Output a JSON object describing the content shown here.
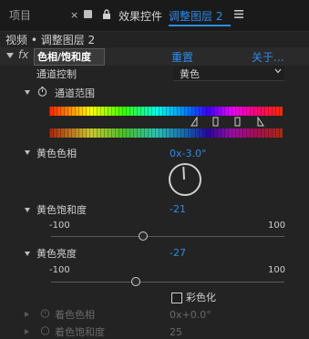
{
  "tabs": {
    "project": "项目",
    "effect_controls_label": "效果控件",
    "layer_name": "调整图层 2"
  },
  "breadcrumb": "视频 • 调整图层 2",
  "effect": {
    "fx_label": "fx",
    "name": "色相/饱和度",
    "reset": "重置",
    "about": "关于..."
  },
  "channel_control": {
    "label": "通道控制",
    "value": "黄色"
  },
  "channel_range": {
    "label": "通道范围"
  },
  "params": {
    "yellow_hue": {
      "label": "黄色色相",
      "value": "0x-3.0°"
    },
    "yellow_saturation": {
      "label": "黄色饱和度",
      "value": "-21",
      "min": "-100",
      "max": "100",
      "level": -21
    },
    "yellow_lightness": {
      "label": "黄色亮度",
      "value": "-27",
      "min": "-100",
      "max": "100",
      "level": -27
    }
  },
  "colorize": {
    "label": "彩色化"
  },
  "faded": {
    "hue": {
      "label": "着色色相",
      "value": "0x+0.0°"
    },
    "saturation": {
      "label": "着色饱和度",
      "value": "25"
    }
  },
  "colors": {
    "accent": "#2d8ceb",
    "background": "#232323"
  }
}
